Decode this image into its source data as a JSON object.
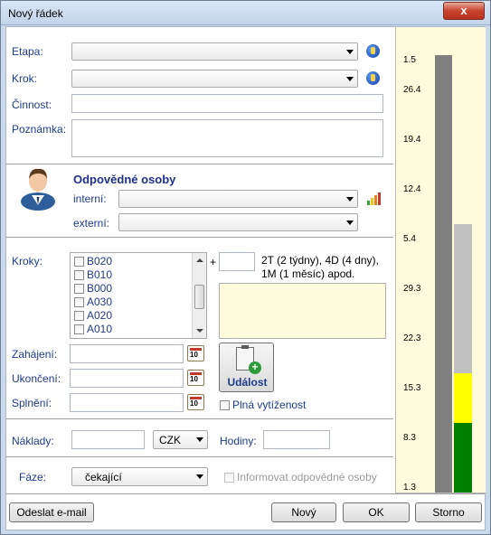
{
  "window": {
    "title": "Nový řádek",
    "close_label": "x"
  },
  "stage": {
    "label": "Etapa:",
    "value": ""
  },
  "step": {
    "label": "Krok:",
    "value": ""
  },
  "activity": {
    "label": "Činnost:",
    "value": ""
  },
  "note": {
    "label": "Poznámka:",
    "value": ""
  },
  "responsible": {
    "heading": "Odpovědné osoby",
    "internal_label": "interní:",
    "internal_value": "",
    "external_label": "externí:",
    "external_value": ""
  },
  "steps": {
    "label": "Kroky:",
    "items": [
      "B020",
      "B010",
      "B000",
      "A030",
      "A020",
      "A010"
    ],
    "plus_symbol": "+",
    "duration_hint": "2T (2 týdny), 4D (4 dny),\n1M (1 měsíc) apod.",
    "duration_value": ""
  },
  "dates": {
    "start_label": "Zahájení:",
    "end_label": "Ukončení:",
    "done_label": "Splnění:",
    "calendar_text": "10"
  },
  "event_button_label": "Událost",
  "full_load_label": "Plná vytíženost",
  "costs": {
    "label": "Náklady:",
    "value": "",
    "currency": "CZK",
    "hours_label": "Hodiny:",
    "hours_value": ""
  },
  "phase": {
    "label": "Fáze:",
    "value": "čekající",
    "notify_label": "Informovat odpovědné osoby"
  },
  "buttons": {
    "send_email": "Odeslat e-mail",
    "new": "Nový",
    "ok": "OK",
    "cancel": "Storno"
  },
  "scale": {
    "ticks": [
      "1.5",
      "26.4",
      "19.4",
      "12.4",
      "5.4",
      "29.3",
      "22.3",
      "15.3",
      "8.3",
      "1.3"
    ],
    "colors": {
      "background": "#fffbdc",
      "gray": "#808080",
      "light": "#c0c0c0",
      "yellow": "#ffff00",
      "green": "#008000"
    }
  }
}
